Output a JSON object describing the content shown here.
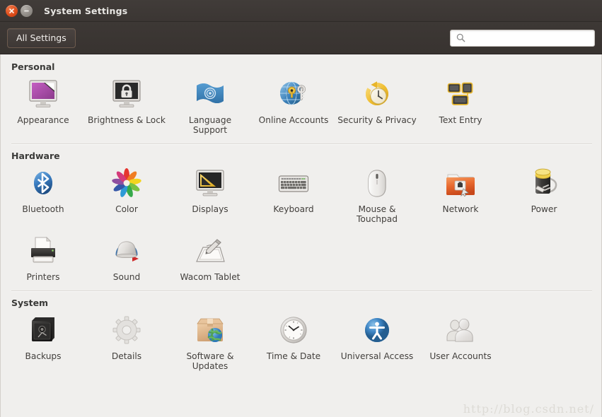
{
  "window": {
    "title": "System Settings",
    "close_icon": "close-icon",
    "minimize_icon": "minimize-icon"
  },
  "toolbar": {
    "all_settings_label": "All Settings",
    "search_icon": "search-icon",
    "search_value": "",
    "search_placeholder": ""
  },
  "watermark": "http://blog.csdn.net/",
  "sections": [
    {
      "title": "Personal",
      "items": [
        {
          "label": "Appearance",
          "icon": "appearance-icon"
        },
        {
          "label": "Brightness & Lock",
          "icon": "brightness-lock-icon"
        },
        {
          "label": "Language Support",
          "icon": "language-support-icon"
        },
        {
          "label": "Online Accounts",
          "icon": "online-accounts-icon"
        },
        {
          "label": "Security & Privacy",
          "icon": "security-privacy-icon"
        },
        {
          "label": "Text Entry",
          "icon": "text-entry-icon"
        }
      ]
    },
    {
      "title": "Hardware",
      "items": [
        {
          "label": "Bluetooth",
          "icon": "bluetooth-icon"
        },
        {
          "label": "Color",
          "icon": "color-icon"
        },
        {
          "label": "Displays",
          "icon": "displays-icon"
        },
        {
          "label": "Keyboard",
          "icon": "keyboard-icon"
        },
        {
          "label": "Mouse & Touchpad",
          "icon": "mouse-touchpad-icon"
        },
        {
          "label": "Network",
          "icon": "network-icon"
        },
        {
          "label": "Power",
          "icon": "power-icon"
        },
        {
          "label": "Printers",
          "icon": "printers-icon"
        },
        {
          "label": "Sound",
          "icon": "sound-icon"
        },
        {
          "label": "Wacom Tablet",
          "icon": "wacom-tablet-icon"
        }
      ]
    },
    {
      "title": "System",
      "items": [
        {
          "label": "Backups",
          "icon": "backups-icon"
        },
        {
          "label": "Details",
          "icon": "details-icon"
        },
        {
          "label": "Software & Updates",
          "icon": "software-updates-icon"
        },
        {
          "label": "Time & Date",
          "icon": "time-date-icon"
        },
        {
          "label": "Universal Access",
          "icon": "universal-access-icon"
        },
        {
          "label": "User Accounts",
          "icon": "user-accounts-icon"
        }
      ]
    }
  ],
  "colors": {
    "titlebar": "#3c3733",
    "close_button": "#dc4a18",
    "minimize_button": "#8f8a85",
    "content_background": "#f0efed",
    "label_text": "#43403d",
    "section_title": "#3a3a38"
  }
}
